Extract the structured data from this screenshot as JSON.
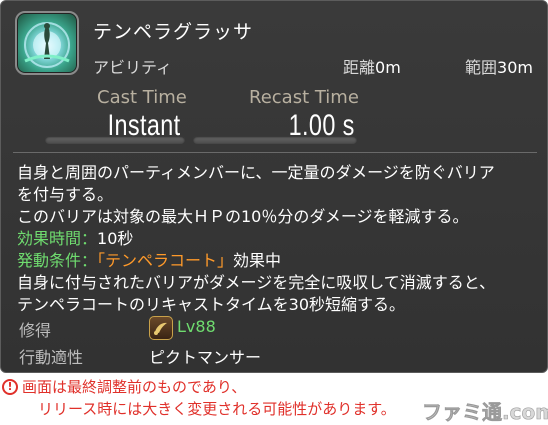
{
  "action": {
    "name": "テンペラグラッサ",
    "type": "アビリティ",
    "icon": "tempera-grassa-icon",
    "range_label": "距離",
    "range_value": "0m",
    "radius_label": "範囲",
    "radius_value": "30m"
  },
  "timing": {
    "cast_label": "Cast Time",
    "cast_value": "Instant",
    "recast_label": "Recast Time",
    "recast_value": "1.00 s"
  },
  "description": {
    "line1": "自身と周囲のパーティメンバーに、一定量のダメージを防ぐバリア",
    "line2": "を付与する。",
    "line3": "このバリアは対象の最大ＨＰの10％分のダメージを軽減する。",
    "duration_label": "効果時間",
    "separator": "：",
    "duration_value": "10秒",
    "condition_label": "発動条件",
    "condition_value": "「テンペラコート」",
    "condition_suffix": "効果中",
    "line6": "自身に付与されたバリアがダメージを完全に吸収して消滅すると、",
    "line7": "テンペラコートのリキャストタイムを30秒短縮する。"
  },
  "requirements": {
    "acquired_label": "修得",
    "job_icon": "pictomancer-job-icon",
    "level": "Lv88",
    "affinity_label": "行動適性",
    "affinity_value": "ピクトマンサー"
  },
  "notice": {
    "icon": "exclamation-icon",
    "line1": "画面は最終調整前のものであり、",
    "line2": "リリース時には大きく変更される可能性があります。"
  },
  "watermark": "ファミ通.com",
  "colors": {
    "tooltip_bg": "#363636",
    "label_green": "#6fdc6f",
    "highlight_orange": "#ff9a2a",
    "notice_red": "#e0302a"
  }
}
